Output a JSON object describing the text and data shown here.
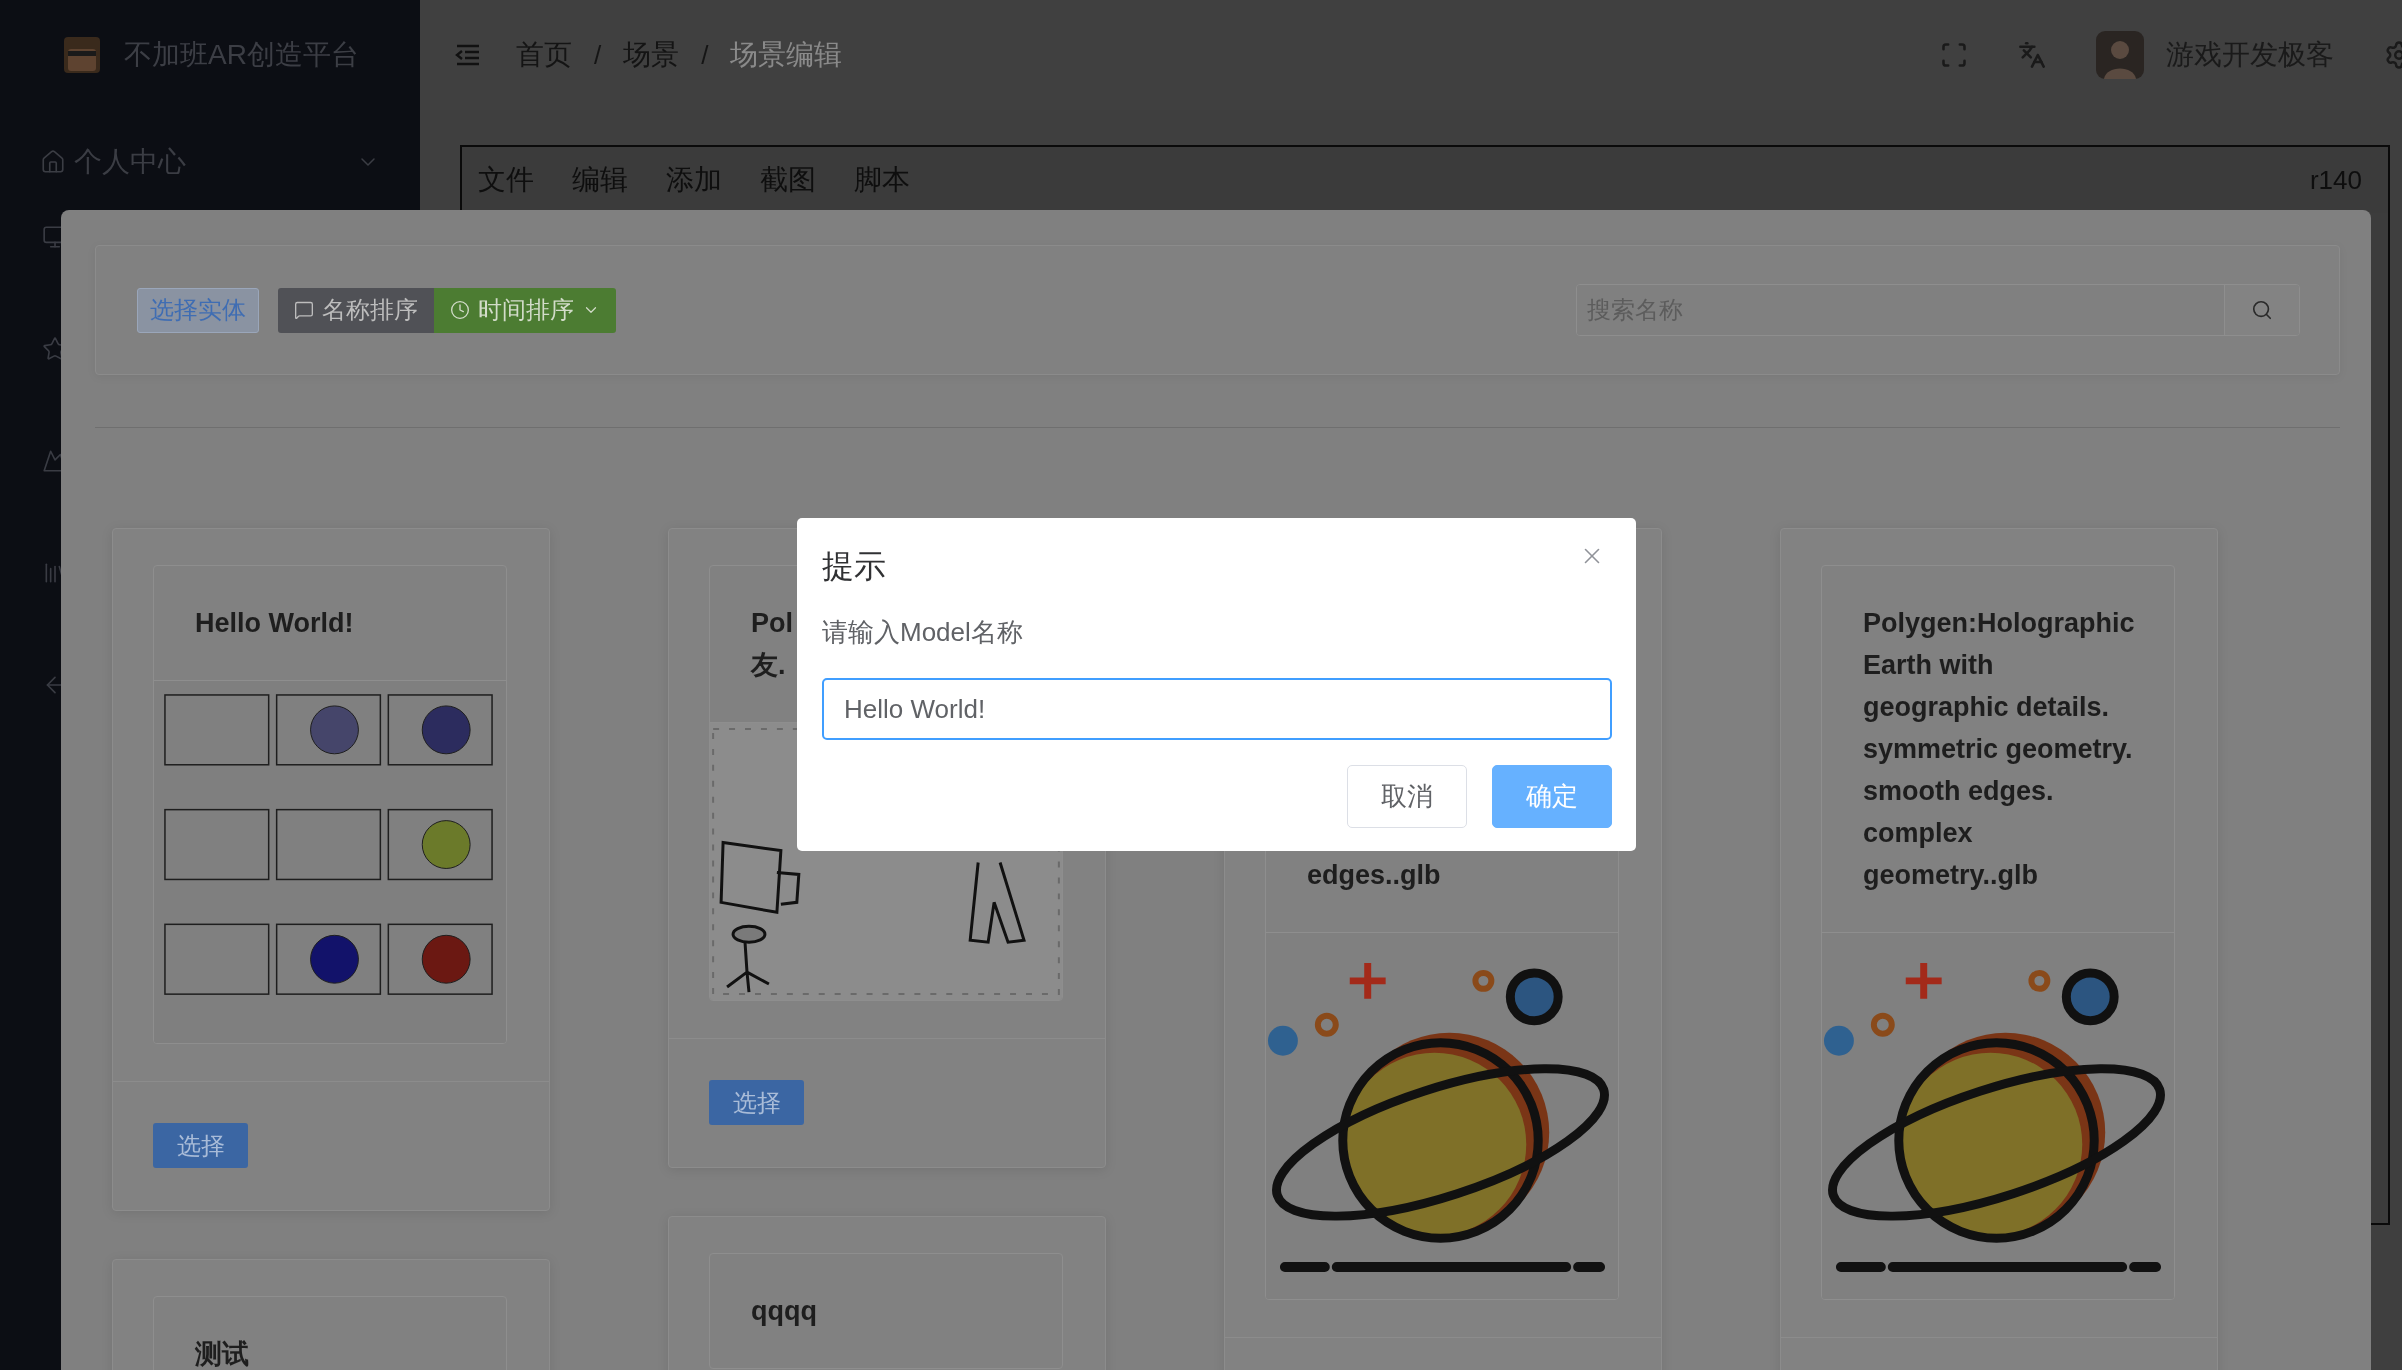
{
  "sidebar": {
    "title": "不加班AR创造平台",
    "menu": [
      {
        "label": "个人中心"
      }
    ]
  },
  "header": {
    "breadcrumb": [
      {
        "label": "首页",
        "current": false
      },
      {
        "separator": "/",
        "label": "场景",
        "current": false
      },
      {
        "separator": "/",
        "label": "场景编辑",
        "current": true
      }
    ],
    "user": {
      "name": "游戏开发极客"
    }
  },
  "editor": {
    "menu": [
      "文件",
      "编辑",
      "添加",
      "截图",
      "脚本"
    ],
    "version": "r140"
  },
  "picker": {
    "select_button": "选择实体",
    "sort_buttons": [
      {
        "label": "名称排序",
        "selected": false
      },
      {
        "label": "时间排序",
        "selected": true
      }
    ],
    "search": {
      "placeholder": "搜索名称"
    },
    "cards": [
      {
        "title": "Hello World!",
        "button": "选择"
      },
      {
        "title": "Pol\n友.",
        "button": "选择"
      },
      {
        "title": "edges..glb"
      },
      {
        "title": "Polygen:Holographic Earth with geographic details. symmetric geometry. smooth edges. complex geometry..glb"
      },
      {
        "title": "测试"
      },
      {
        "title": "qqqq"
      }
    ]
  },
  "dialog": {
    "title": "提示",
    "message": "请输入Model名称",
    "input": {
      "value": "Hello World!"
    },
    "buttons": [
      {
        "label": "取消",
        "kind": "secondary"
      },
      {
        "label": "确定",
        "kind": "primary"
      }
    ]
  }
}
